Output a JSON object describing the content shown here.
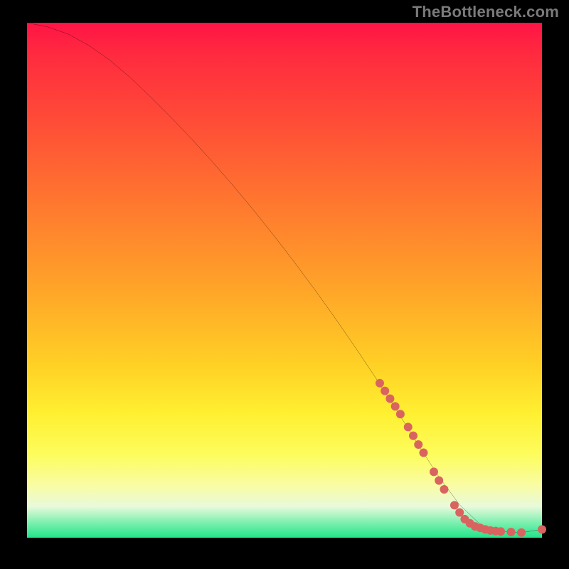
{
  "watermark": {
    "text": "TheBottleneck.com"
  },
  "chart_data": {
    "type": "line",
    "title": "",
    "xlabel": "",
    "ylabel": "",
    "xlim": [
      0,
      100
    ],
    "ylim": [
      0,
      100
    ],
    "grid": false,
    "legend": null,
    "series": [
      {
        "name": "bottleneck-curve",
        "x": [
          0,
          4,
          8,
          12,
          16,
          20,
          24,
          28,
          32,
          36,
          40,
          44,
          48,
          52,
          56,
          60,
          64,
          68,
          72,
          76,
          80,
          84,
          88,
          92,
          96,
          100
        ],
        "y": [
          100,
          99.2,
          97.8,
          95.6,
          92.8,
          89.4,
          85.6,
          81.6,
          77.4,
          73.0,
          68.4,
          63.6,
          58.6,
          53.4,
          48.0,
          42.4,
          36.6,
          30.6,
          24.4,
          18.0,
          11.8,
          6.4,
          2.6,
          1.2,
          1.0,
          1.6
        ],
        "stroke": "#000000",
        "stroke_width": 2
      }
    ],
    "markers": {
      "name": "highlighted-points",
      "color": "#d9645f",
      "radius": 6,
      "points": [
        {
          "x": 68.5,
          "y": 30.0
        },
        {
          "x": 69.5,
          "y": 28.5
        },
        {
          "x": 70.5,
          "y": 27.0
        },
        {
          "x": 71.5,
          "y": 25.5
        },
        {
          "x": 72.5,
          "y": 24.0
        },
        {
          "x": 74.0,
          "y": 21.5
        },
        {
          "x": 75.0,
          "y": 19.8
        },
        {
          "x": 76.0,
          "y": 18.1
        },
        {
          "x": 77.0,
          "y": 16.5
        },
        {
          "x": 79.0,
          "y": 12.8
        },
        {
          "x": 80.0,
          "y": 11.1
        },
        {
          "x": 81.0,
          "y": 9.4
        },
        {
          "x": 83.0,
          "y": 6.3
        },
        {
          "x": 84.0,
          "y": 4.9
        },
        {
          "x": 85.0,
          "y": 3.6
        },
        {
          "x": 86.0,
          "y": 2.8
        },
        {
          "x": 87.0,
          "y": 2.2
        },
        {
          "x": 88.0,
          "y": 1.9
        },
        {
          "x": 89.0,
          "y": 1.6
        },
        {
          "x": 90.0,
          "y": 1.4
        },
        {
          "x": 91.0,
          "y": 1.3
        },
        {
          "x": 92.0,
          "y": 1.2
        },
        {
          "x": 94.0,
          "y": 1.1
        },
        {
          "x": 96.0,
          "y": 1.0
        },
        {
          "x": 100.0,
          "y": 1.6
        }
      ]
    }
  }
}
